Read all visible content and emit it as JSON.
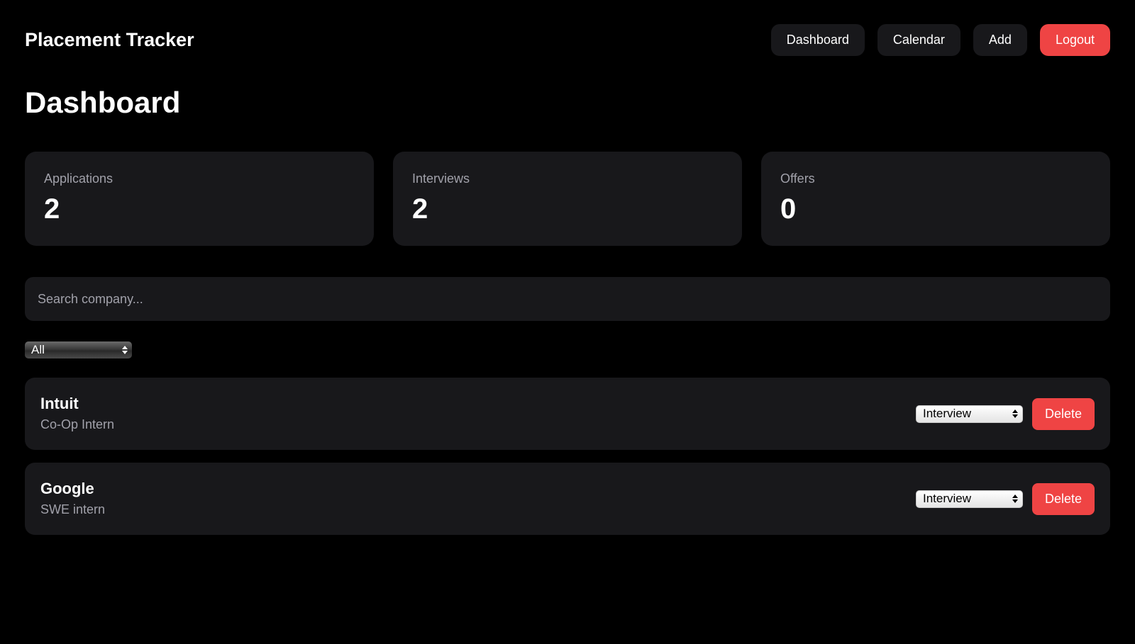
{
  "header": {
    "brand": "Placement Tracker",
    "nav": {
      "dashboard": "Dashboard",
      "calendar": "Calendar",
      "add": "Add",
      "logout": "Logout"
    }
  },
  "page_title": "Dashboard",
  "stats": {
    "applications": {
      "label": "Applications",
      "value": "2"
    },
    "interviews": {
      "label": "Interviews",
      "value": "2"
    },
    "offers": {
      "label": "Offers",
      "value": "0"
    }
  },
  "search": {
    "placeholder": "Search company..."
  },
  "filter": {
    "selected": "All"
  },
  "applications": [
    {
      "company": "Intuit",
      "role": "Co-Op Intern",
      "status": "Interview",
      "delete_label": "Delete"
    },
    {
      "company": "Google",
      "role": "SWE intern",
      "status": "Interview",
      "delete_label": "Delete"
    }
  ],
  "colors": {
    "background": "#000000",
    "card": "#18181b",
    "accent_red": "#ef4444",
    "muted_text": "#a1a1aa"
  }
}
